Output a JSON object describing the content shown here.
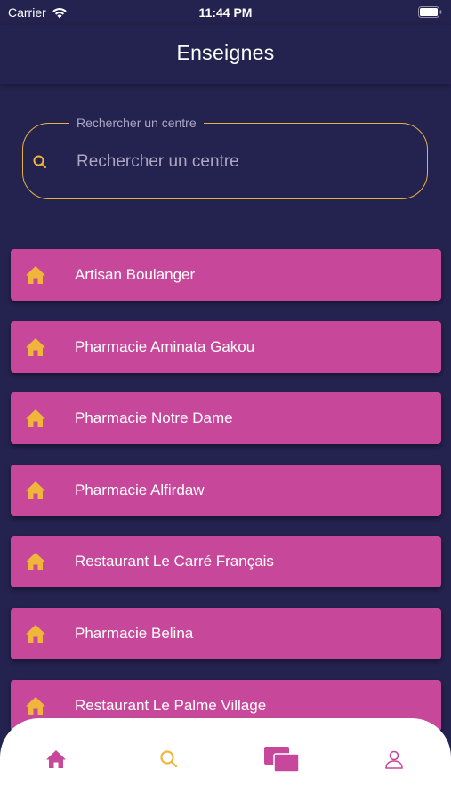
{
  "status_bar": {
    "carrier": "Carrier",
    "time": "11:44 PM"
  },
  "header": {
    "title": "Enseignes"
  },
  "search": {
    "label": "Rechercher un centre",
    "placeholder": "Rechercher un centre",
    "value": ""
  },
  "stores": [
    {
      "label": "Artisan Boulanger"
    },
    {
      "label": "Pharmacie Aminata Gakou"
    },
    {
      "label": "Pharmacie Notre Dame"
    },
    {
      "label": "Pharmacie Alfirdaw"
    },
    {
      "label": "Restaurant Le Carré Français"
    },
    {
      "label": "Pharmacie Belina"
    },
    {
      "label": "Restaurant Le Palme Village"
    }
  ],
  "tab_bar": {
    "tabs": [
      {
        "icon": "home-icon",
        "active": true
      },
      {
        "icon": "search-icon",
        "active": false
      },
      {
        "icon": "cards-icon",
        "active": false
      },
      {
        "icon": "user-icon",
        "active": false
      }
    ]
  },
  "colors": {
    "background": "#24224f",
    "item": "#c7489a",
    "accent": "#f0b63c",
    "tab_active": "#c7489a",
    "search_border": "#e9b23f"
  }
}
